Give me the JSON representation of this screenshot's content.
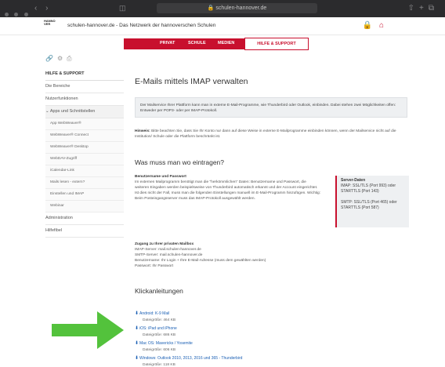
{
  "browser": {
    "url": "schulen-hannover.de"
  },
  "header": {
    "logo_text": "HANNOVER",
    "site_name": "schulen-hannover.de - Das Netzwerk der hannoverschen Schulen"
  },
  "nav": {
    "items": [
      "PRIVAT",
      "SCHULE",
      "MEDIEN"
    ],
    "active": "HILFE & SUPPORT"
  },
  "sidebar": {
    "title": "HILFE & SUPPORT",
    "items": [
      "Die Bereiche",
      "Nutzerfunktionen",
      "Apps und Schnittstellen"
    ],
    "subitems": [
      "App WebWeaver®",
      "WebWeaver® Connect",
      "WebWeaver® Desktop",
      "WebDAV-Zugriff",
      "iCalendar-Link",
      "Mails lesen - extern?",
      "Einstellen und IMAP",
      "Webinar"
    ],
    "items_after": [
      "Administration",
      "Hilfefibel"
    ]
  },
  "main": {
    "title": "E-Mails mittels IMAP verwalten",
    "note": "Der Mailservice Ihrer Plattform kann man in externe E-Mail-Programme, wie Thunderbird oder Outlook, einbinden. Dabei stehen zwei Möglichkeiten offen: Entweder per POP3- oder per IMAP-Protokoll.",
    "hint_label": "Hinweis:",
    "hint_text": "Bitte beachten Sie, dass Sie Ihr Konto nur dann auf diese Weise in externe E-Mailprogramme einbinden können, wenn der Mailservice nicht auf die Institution/ Schule oder die Plattform beschränkt ist.",
    "section1": "Was muss man wo eintragen?",
    "bp_title": "Benutzername und Passwort",
    "bp_text": "Im externen Mailprogramm benötigt man die \"herkömmlichen\" Daten: Benutzername und Passwort, die weiteren Eingaben werden beispielsweise von Thunderbird automatisch erkannt und der Account eingerichtet. Ist dies nicht der Fall, muss man die folgenden Einstellungen manuell im E-Mail-Programm hinzufügen. Wichtig: Beim Posteingangsserver muss das IMAP-Protokoll ausgewählt werden.",
    "server_title": "Server-Daten",
    "server_imap": "IMAP: SSL/TLS (Port 993) oder STARTTLS (Port 143)",
    "server_smtp": "SMTP: SSL/TLS (Port 465) oder STARTTLS (Port 587)",
    "private_title": "Zugang zu Ihrer privaten Mailbox",
    "private_lines": [
      "IMAP-Server: mail.schulen-hannover.de",
      "SMTP-Server: mail.schulen-hannover.de",
      "Benutzername: Ihr Login + Ihre E-Mail-Adresse (muss dem gewählten werden)",
      "Passwort: Ihr Passwort"
    ],
    "section2": "Klickanleitungen",
    "downloads": [
      {
        "name": "Android: K-9 Mail",
        "size": "Dateigröße: 464 KB"
      },
      {
        "name": "iOS: iPad und iPhone",
        "size": "Dateigröße: 686 KB"
      },
      {
        "name": "Mac OS: Mavericks / Yosemite",
        "size": "Dateigröße: 606 KB"
      },
      {
        "name": "Windows: Outlook 2010, 2013, 2016 und 365 - Thunderbird",
        "size": "Dateigröße: 118 KB"
      }
    ]
  },
  "colors": {
    "brand_red": "#c8102e",
    "arrow_green": "#53c23c",
    "link_blue": "#1a5fb4"
  }
}
